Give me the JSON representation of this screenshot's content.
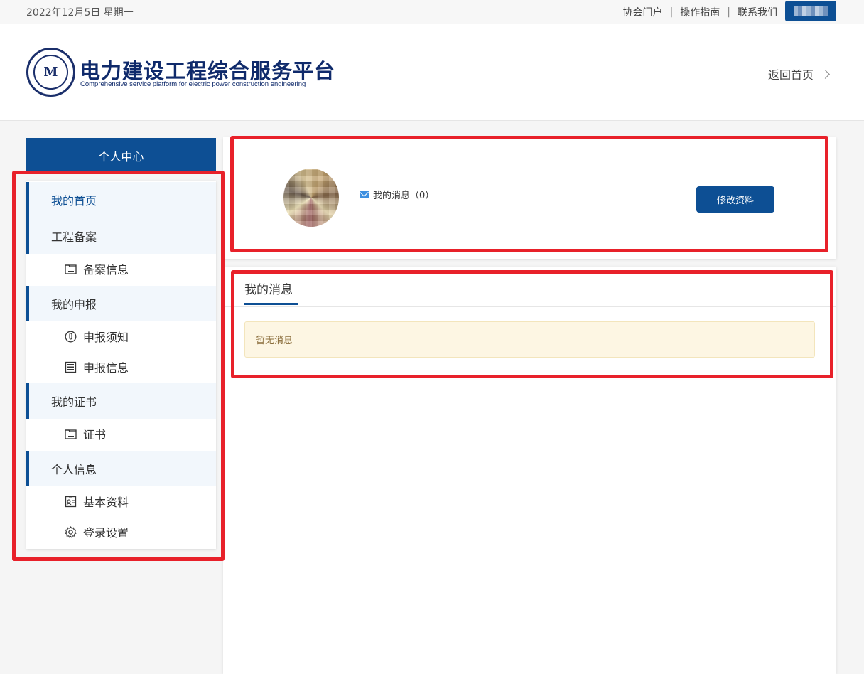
{
  "topbar": {
    "date": "2022年12月5日 星期一",
    "links": [
      "协会门户",
      "操作指南",
      "联系我们"
    ]
  },
  "header": {
    "title": "电力建设工程综合服务平台",
    "subtitle": "Comprehensive service platform for electric power construction engineering",
    "back_home": "返回首页"
  },
  "sidebar": {
    "title": "个人中心",
    "items": {
      "home": "我的首页",
      "project_group": "工程备案",
      "filing_info": "备案信息",
      "apply_group": "我的申报",
      "apply_notice": "申报须知",
      "apply_info": "申报信息",
      "cert_group": "我的证书",
      "cert": "证书",
      "personal_group": "个人信息",
      "basic_info": "基本资料",
      "login_settings": "登录设置"
    }
  },
  "profile": {
    "messages_label": "我的消息（0）",
    "edit_button": "修改资料"
  },
  "messages": {
    "tab": "我的消息",
    "empty": "暂无消息"
  },
  "colors": {
    "primary": "#0d4f94",
    "annotation": "#e8212a"
  }
}
